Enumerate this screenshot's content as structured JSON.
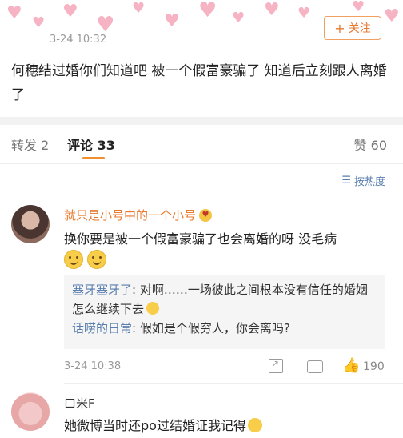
{
  "post": {
    "time": "3-24 10:32",
    "follow_label": "关注",
    "text": "何穗结过婚你们知道吧  被一个假富豪骗了  知道后立刻跟人离婚了"
  },
  "tabs": {
    "repost": "转发 2",
    "comment": "评论 33",
    "like": "赞 60"
  },
  "sort_label": "按热度",
  "comments": [
    {
      "user": "就只是小号中的一个小号",
      "text": "换你要是被一个假富豪骗了也会离婚的呀 没毛病",
      "replies": [
        {
          "user": "塞牙塞牙了",
          "sep": ": ",
          "text": "对啊……一场彼此之间根本没有信任的婚姻 怎么继续下去"
        },
        {
          "user": "话唠的日常",
          "sep": ": ",
          "text": "假如是个假穷人，你会离吗?"
        }
      ],
      "time": "3-24 10:38",
      "likes": "190"
    },
    {
      "user": "口米F",
      "text": "她微博当时还po过结婚证我记得"
    }
  ],
  "colors": {
    "accent": "#e8792f",
    "link": "#5a7fae",
    "heart": "#f6b3c3"
  }
}
